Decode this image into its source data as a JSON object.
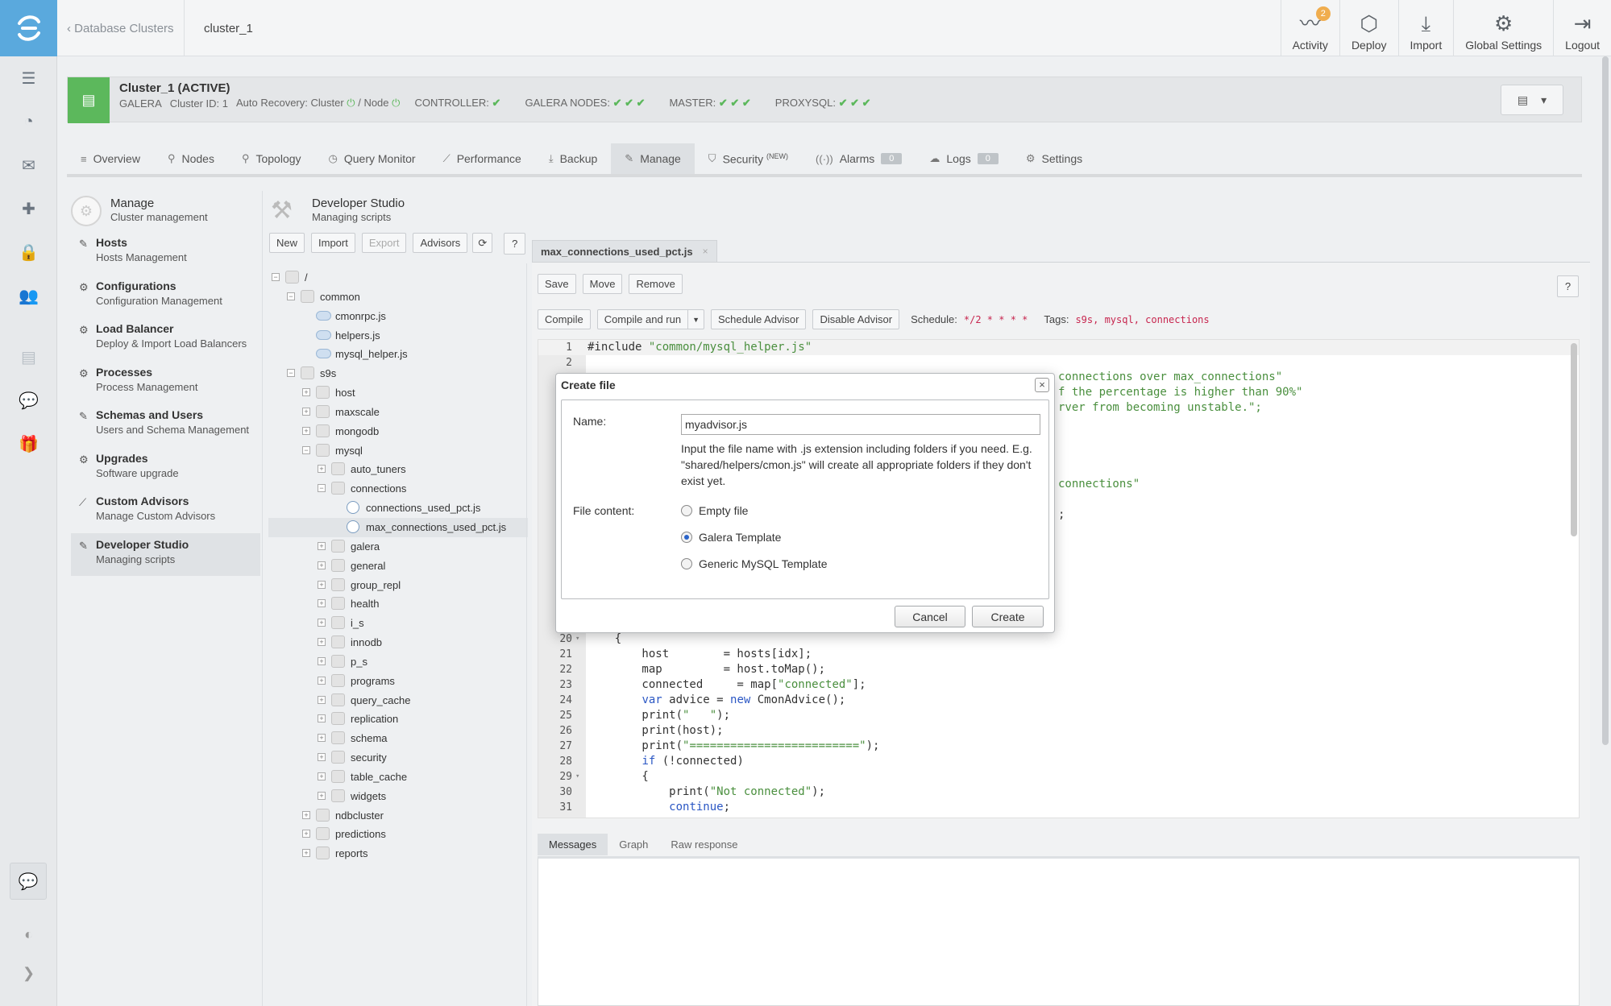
{
  "topbar": {
    "back_label": "‹ Database Clusters",
    "current": "cluster_1",
    "actions": [
      {
        "label": "Activity",
        "icon": "activity-icon",
        "glyph": "〰",
        "badge": "2"
      },
      {
        "label": "Deploy",
        "icon": "deploy-icon",
        "glyph": "⬡"
      },
      {
        "label": "Import",
        "icon": "import-icon",
        "glyph": "⤓"
      },
      {
        "label": "Global Settings",
        "icon": "gear-icon",
        "glyph": "⚙"
      },
      {
        "label": "Logout",
        "icon": "logout-icon",
        "glyph": "⇥"
      }
    ]
  },
  "cluster": {
    "title": "Cluster_1 (ACTIVE)",
    "type": "GALERA",
    "id": "Cluster ID: 1",
    "auto_recovery": "Auto Recovery: Cluster",
    "node": "/ Node",
    "controller": "CONTROLLER:",
    "galera_nodes": "GALERA NODES:",
    "master": "MASTER:",
    "proxysql": "PROXYSQL:"
  },
  "tabs": [
    {
      "label": "Overview",
      "icon": "list-icon",
      "glyph": "≡"
    },
    {
      "label": "Nodes",
      "icon": "nodes-icon",
      "glyph": "⚲"
    },
    {
      "label": "Topology",
      "icon": "topology-icon",
      "glyph": "⚲"
    },
    {
      "label": "Query Monitor",
      "icon": "clock-icon",
      "glyph": "◷"
    },
    {
      "label": "Performance",
      "icon": "chart-icon",
      "glyph": "⟋"
    },
    {
      "label": "Backup",
      "icon": "backup-icon",
      "glyph": "⤓"
    },
    {
      "label": "Manage",
      "icon": "wrench-icon",
      "glyph": "✎",
      "active": true
    },
    {
      "label": "Security",
      "sup": "(NEW)",
      "icon": "shield-icon",
      "glyph": "⛉"
    },
    {
      "label": "Alarms",
      "count": "0",
      "icon": "alarm-icon",
      "glyph": "((·))"
    },
    {
      "label": "Logs",
      "count": "0",
      "icon": "logs-icon",
      "glyph": "☁"
    },
    {
      "label": "Settings",
      "icon": "gear-icon",
      "glyph": "⚙"
    }
  ],
  "manage": {
    "title": "Manage",
    "subtitle": "Cluster management",
    "items": [
      {
        "title": "Hosts",
        "sub": "Hosts Management",
        "icon": "wrench-icon",
        "glyph": "✎"
      },
      {
        "title": "Configurations",
        "sub": "Configuration Management",
        "icon": "gear-icon",
        "glyph": "⚙"
      },
      {
        "title": "Load Balancer",
        "sub": "Deploy & Import Load Balancers",
        "icon": "gear-icon",
        "glyph": "⚙"
      },
      {
        "title": "Processes",
        "sub": "Process Management",
        "icon": "gear-icon",
        "glyph": "⚙"
      },
      {
        "title": "Schemas and Users",
        "sub": "Users and Schema Management",
        "icon": "wrench-icon",
        "glyph": "✎"
      },
      {
        "title": "Upgrades",
        "sub": "Software upgrade",
        "icon": "gear-icon",
        "glyph": "⚙"
      },
      {
        "title": "Custom Advisors",
        "sub": "Manage Custom Advisors",
        "icon": "chart-icon",
        "glyph": "⟋"
      },
      {
        "title": "Developer Studio",
        "sub": "Managing scripts",
        "icon": "wrench-icon",
        "glyph": "✎",
        "selected": true
      }
    ]
  },
  "studio": {
    "title": "Developer Studio",
    "subtitle": "Managing scripts",
    "tools": [
      {
        "label": "New"
      },
      {
        "label": "Import"
      },
      {
        "label": "Export",
        "disabled": true
      },
      {
        "label": "Advisors"
      },
      {
        "label": "⟳",
        "icon": "refresh-icon"
      },
      {
        "label": "?",
        "icon": "help-icon"
      }
    ]
  },
  "tree": [
    {
      "label": "/",
      "depth": 0,
      "kind": "folder",
      "exp": "−"
    },
    {
      "label": "common",
      "depth": 1,
      "kind": "folder",
      "exp": "−"
    },
    {
      "label": "cmonrpc.js",
      "depth": 2,
      "kind": "js"
    },
    {
      "label": "helpers.js",
      "depth": 2,
      "kind": "js"
    },
    {
      "label": "mysql_helper.js",
      "depth": 2,
      "kind": "js"
    },
    {
      "label": "s9s",
      "depth": 1,
      "kind": "folder",
      "exp": "−"
    },
    {
      "label": "host",
      "depth": 2,
      "kind": "folder",
      "exp": "+"
    },
    {
      "label": "maxscale",
      "depth": 2,
      "kind": "folder",
      "exp": "+"
    },
    {
      "label": "mongodb",
      "depth": 2,
      "kind": "folder",
      "exp": "+"
    },
    {
      "label": "mysql",
      "depth": 2,
      "kind": "folder",
      "exp": "−"
    },
    {
      "label": "auto_tuners",
      "depth": 3,
      "kind": "folder",
      "exp": "+"
    },
    {
      "label": "connections",
      "depth": 3,
      "kind": "folder",
      "exp": "−"
    },
    {
      "label": "connections_used_pct.js",
      "depth": 4,
      "kind": "adv"
    },
    {
      "label": "max_connections_used_pct.js",
      "depth": 4,
      "kind": "adv",
      "selected": true
    },
    {
      "label": "galera",
      "depth": 3,
      "kind": "folder",
      "exp": "+"
    },
    {
      "label": "general",
      "depth": 3,
      "kind": "folder",
      "exp": "+"
    },
    {
      "label": "group_repl",
      "depth": 3,
      "kind": "folder",
      "exp": "+"
    },
    {
      "label": "health",
      "depth": 3,
      "kind": "folder",
      "exp": "+"
    },
    {
      "label": "i_s",
      "depth": 3,
      "kind": "folder",
      "exp": "+"
    },
    {
      "label": "innodb",
      "depth": 3,
      "kind": "folder",
      "exp": "+"
    },
    {
      "label": "p_s",
      "depth": 3,
      "kind": "folder",
      "exp": "+"
    },
    {
      "label": "programs",
      "depth": 3,
      "kind": "folder",
      "exp": "+"
    },
    {
      "label": "query_cache",
      "depth": 3,
      "kind": "folder",
      "exp": "+"
    },
    {
      "label": "replication",
      "depth": 3,
      "kind": "folder",
      "exp": "+"
    },
    {
      "label": "schema",
      "depth": 3,
      "kind": "folder",
      "exp": "+"
    },
    {
      "label": "security",
      "depth": 3,
      "kind": "folder",
      "exp": "+"
    },
    {
      "label": "table_cache",
      "depth": 3,
      "kind": "folder",
      "exp": "+"
    },
    {
      "label": "widgets",
      "depth": 3,
      "kind": "folder",
      "exp": "+"
    },
    {
      "label": "ndbcluster",
      "depth": 2,
      "kind": "folder",
      "exp": "+"
    },
    {
      "label": "predictions",
      "depth": 2,
      "kind": "folder",
      "exp": "+"
    },
    {
      "label": "reports",
      "depth": 2,
      "kind": "folder",
      "exp": "+"
    }
  ],
  "editor": {
    "file_tab": "max_connections_used_pct.js",
    "close_glyph": "×",
    "row1": [
      "Save",
      "Move",
      "Remove"
    ],
    "help": "?",
    "compile": "Compile",
    "compile_run": "Compile and run",
    "caret": "▼",
    "schedule_advisor": "Schedule Advisor",
    "disable_advisor": "Disable Advisor",
    "schedule_label": "Schedule:",
    "schedule_value": "*/2 * * * *",
    "tags_label": "Tags:",
    "tags_value": "s9s, mysql, connections",
    "lines_top": [
      {
        "n": "1",
        "parts": [
          {
            "t": "#include "
          },
          {
            "t": "\"common/mysql_helper.js\"",
            "c": "str"
          }
        ]
      },
      {
        "n": "2",
        "parts": []
      }
    ],
    "hidden_fragments": [
      "connections over max_connections\"",
      "f the percentage is higher than 90%\"",
      "rver from becoming unstable.\";",
      "connections\"",
      ";"
    ],
    "lines_bottom": [
      {
        "n": "20",
        "fold": true,
        "parts": [
          {
            "t": "    {"
          }
        ]
      },
      {
        "n": "21",
        "parts": [
          {
            "t": "        host        = hosts[idx];"
          }
        ]
      },
      {
        "n": "22",
        "parts": [
          {
            "t": "        map         = host.toMap();"
          }
        ]
      },
      {
        "n": "23",
        "parts": [
          {
            "t": "        connected     = map["
          },
          {
            "t": "\"connected\"",
            "c": "str"
          },
          {
            "t": "];"
          }
        ]
      },
      {
        "n": "24",
        "parts": [
          {
            "t": "        "
          },
          {
            "t": "var",
            "c": "kw"
          },
          {
            "t": " advice = "
          },
          {
            "t": "new",
            "c": "kw"
          },
          {
            "t": " CmonAdvice();"
          }
        ]
      },
      {
        "n": "25",
        "parts": [
          {
            "t": "        print("
          },
          {
            "t": "\"   \"",
            "c": "str"
          },
          {
            "t": ");"
          }
        ]
      },
      {
        "n": "26",
        "parts": [
          {
            "t": "        print(host);"
          }
        ]
      },
      {
        "n": "27",
        "parts": [
          {
            "t": "        print("
          },
          {
            "t": "\"=========================\"",
            "c": "str"
          },
          {
            "t": ");"
          }
        ]
      },
      {
        "n": "28",
        "parts": [
          {
            "t": "        "
          },
          {
            "t": "if",
            "c": "kw"
          },
          {
            "t": " (!connected)"
          }
        ]
      },
      {
        "n": "29",
        "fold": true,
        "parts": [
          {
            "t": "        {"
          }
        ]
      },
      {
        "n": "30",
        "parts": [
          {
            "t": "            print("
          },
          {
            "t": "\"Not connected\"",
            "c": "str"
          },
          {
            "t": ");"
          }
        ]
      },
      {
        "n": "31",
        "parts": [
          {
            "t": "            "
          },
          {
            "t": "continue",
            "c": "kw"
          },
          {
            "t": ";"
          }
        ]
      }
    ],
    "msg_tabs": [
      "Messages",
      "Graph",
      "Raw response"
    ]
  },
  "modal": {
    "title": "Create file",
    "close": "×",
    "name_label": "Name:",
    "name_value": "myadvisor.js",
    "hint": "Input the file name with .js extension including folders if you need. E.g. \"shared/helpers/cmon.js\" will create all appropriate folders if they don't exist yet.",
    "content_label": "File content:",
    "options": [
      {
        "label": "Empty file",
        "checked": false
      },
      {
        "label": "Galera Template",
        "checked": true
      },
      {
        "label": "Generic MySQL Template",
        "checked": false
      }
    ],
    "cancel": "Cancel",
    "create": "Create"
  },
  "rail": {
    "items": [
      {
        "icon": "clusters-icon",
        "glyph": "☰"
      },
      {
        "icon": "pie-chart-icon",
        "glyph": "◔"
      },
      {
        "icon": "mail-icon",
        "glyph": "✉"
      },
      {
        "icon": "integrations-icon",
        "glyph": "✚"
      },
      {
        "icon": "lock-icon",
        "glyph": "🔒"
      },
      {
        "icon": "users-icon",
        "glyph": "👥"
      },
      {
        "icon": "book-icon",
        "glyph": "▤",
        "faded": true
      },
      {
        "icon": "chat-icon",
        "glyph": "💬",
        "faded": true
      },
      {
        "icon": "gift-icon",
        "glyph": "🎁",
        "faded": true
      }
    ],
    "chat_glyph": "💬",
    "toggle_glyph": "◐",
    "expand_glyph": "❯"
  },
  "colors": {
    "accent": "#5aa9dd",
    "ok": "#5cb85c",
    "string": "#4a8f3e",
    "keyword": "#2b57c4",
    "tag": "#c7254e"
  }
}
